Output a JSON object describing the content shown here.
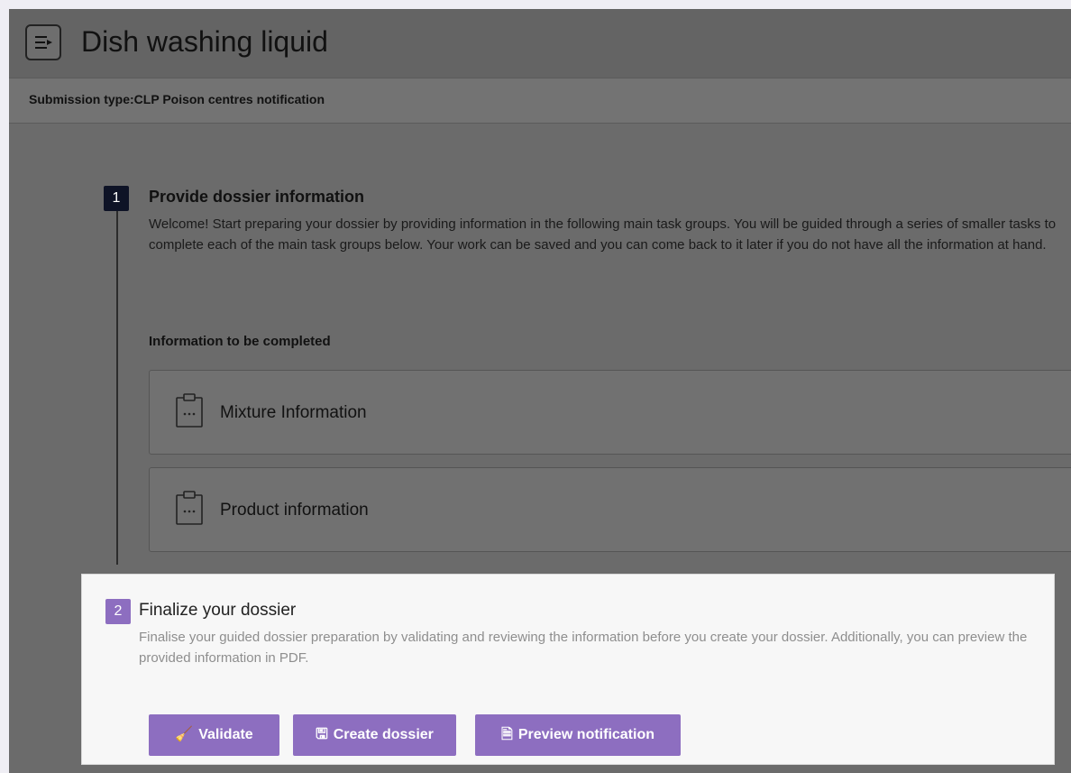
{
  "header": {
    "title": "Dish washing liquid",
    "menu_icon": "menu-toggle-icon"
  },
  "subheader": {
    "submission_type": "Submission type:CLP Poison centres notification"
  },
  "steps": [
    {
      "number": "1",
      "title": "Provide dossier information",
      "description": "Welcome! Start preparing your dossier by providing information in the following main task groups. You will be guided through a series of smaller tasks to complete each of the main task groups below. Your work can be saved and you can come back to it later if you do not have all the information at hand.",
      "section_label": "Information to be completed",
      "tasks": [
        {
          "label": "Mixture Information",
          "icon": "clipboard-icon"
        },
        {
          "label": "Product information",
          "icon": "clipboard-icon"
        }
      ]
    },
    {
      "number": "2",
      "title": "Finalize your dossier",
      "description": "Finalise your guided dossier preparation by validating and reviewing the information before you create your dossier. Additionally, you can preview the provided information in PDF.",
      "actions": [
        {
          "label": "Validate",
          "icon": "broom-icon",
          "glyph": "🧹"
        },
        {
          "label": "Create dossier",
          "icon": "save-icon",
          "glyph": "🖫"
        },
        {
          "label": "Preview notification",
          "icon": "document-preview-icon",
          "glyph": "🗎"
        }
      ]
    }
  ],
  "colors": {
    "accent": "#8d6ec0",
    "step1_badge": "#0e1326",
    "overlay": "#6b6b6b",
    "panel": "#f7f7f7"
  }
}
